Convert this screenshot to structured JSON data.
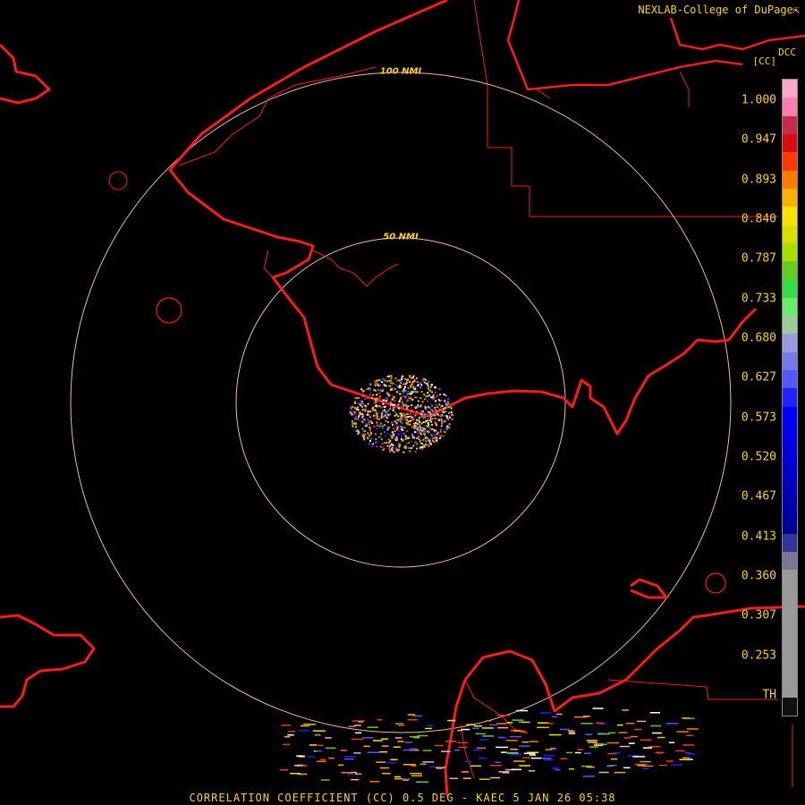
{
  "credit": "NEXLAB-College of DuPage",
  "product_code": "DCC",
  "unit": "[CC]",
  "caption": "CORRELATION COEFFICIENT (CC) 0.5 DEG - KAEC 5 JAN 26 05:38",
  "range_rings": [
    {
      "label": "100 NMI"
    },
    {
      "label": "50 NMI"
    }
  ],
  "legend_ticks": [
    "1.000",
    "0.947",
    "0.893",
    "0.840",
    "0.787",
    "0.733",
    "0.680",
    "0.627",
    "0.573",
    "0.520",
    "0.467",
    "0.413",
    "0.360",
    "0.307",
    "0.253",
    "TH"
  ],
  "colors": {
    "coast": "#ff1a1a",
    "rings": "#f2b8a8",
    "text": "#ffd21a",
    "colorbar": [
      "#ffa6c9",
      "#f97fb0",
      "#c82a4a",
      "#d80d0d",
      "#ff3a00",
      "#ff7a00",
      "#ffb000",
      "#ffe000",
      "#d8e000",
      "#aadd00",
      "#66cc22",
      "#33dd44",
      "#66ee66",
      "#99cc99",
      "#9999dd",
      "#7777ee",
      "#5555ff",
      "#2222ff",
      "#0000ff",
      "#0000ee",
      "#0000dd",
      "#0000cc",
      "#0000bb",
      "#0000aa",
      "#000099",
      "#333399",
      "#777799",
      "#999999",
      "#999999",
      "#999999",
      "#999999",
      "#999999",
      "#999999",
      "#999999",
      "#111111"
    ]
  }
}
